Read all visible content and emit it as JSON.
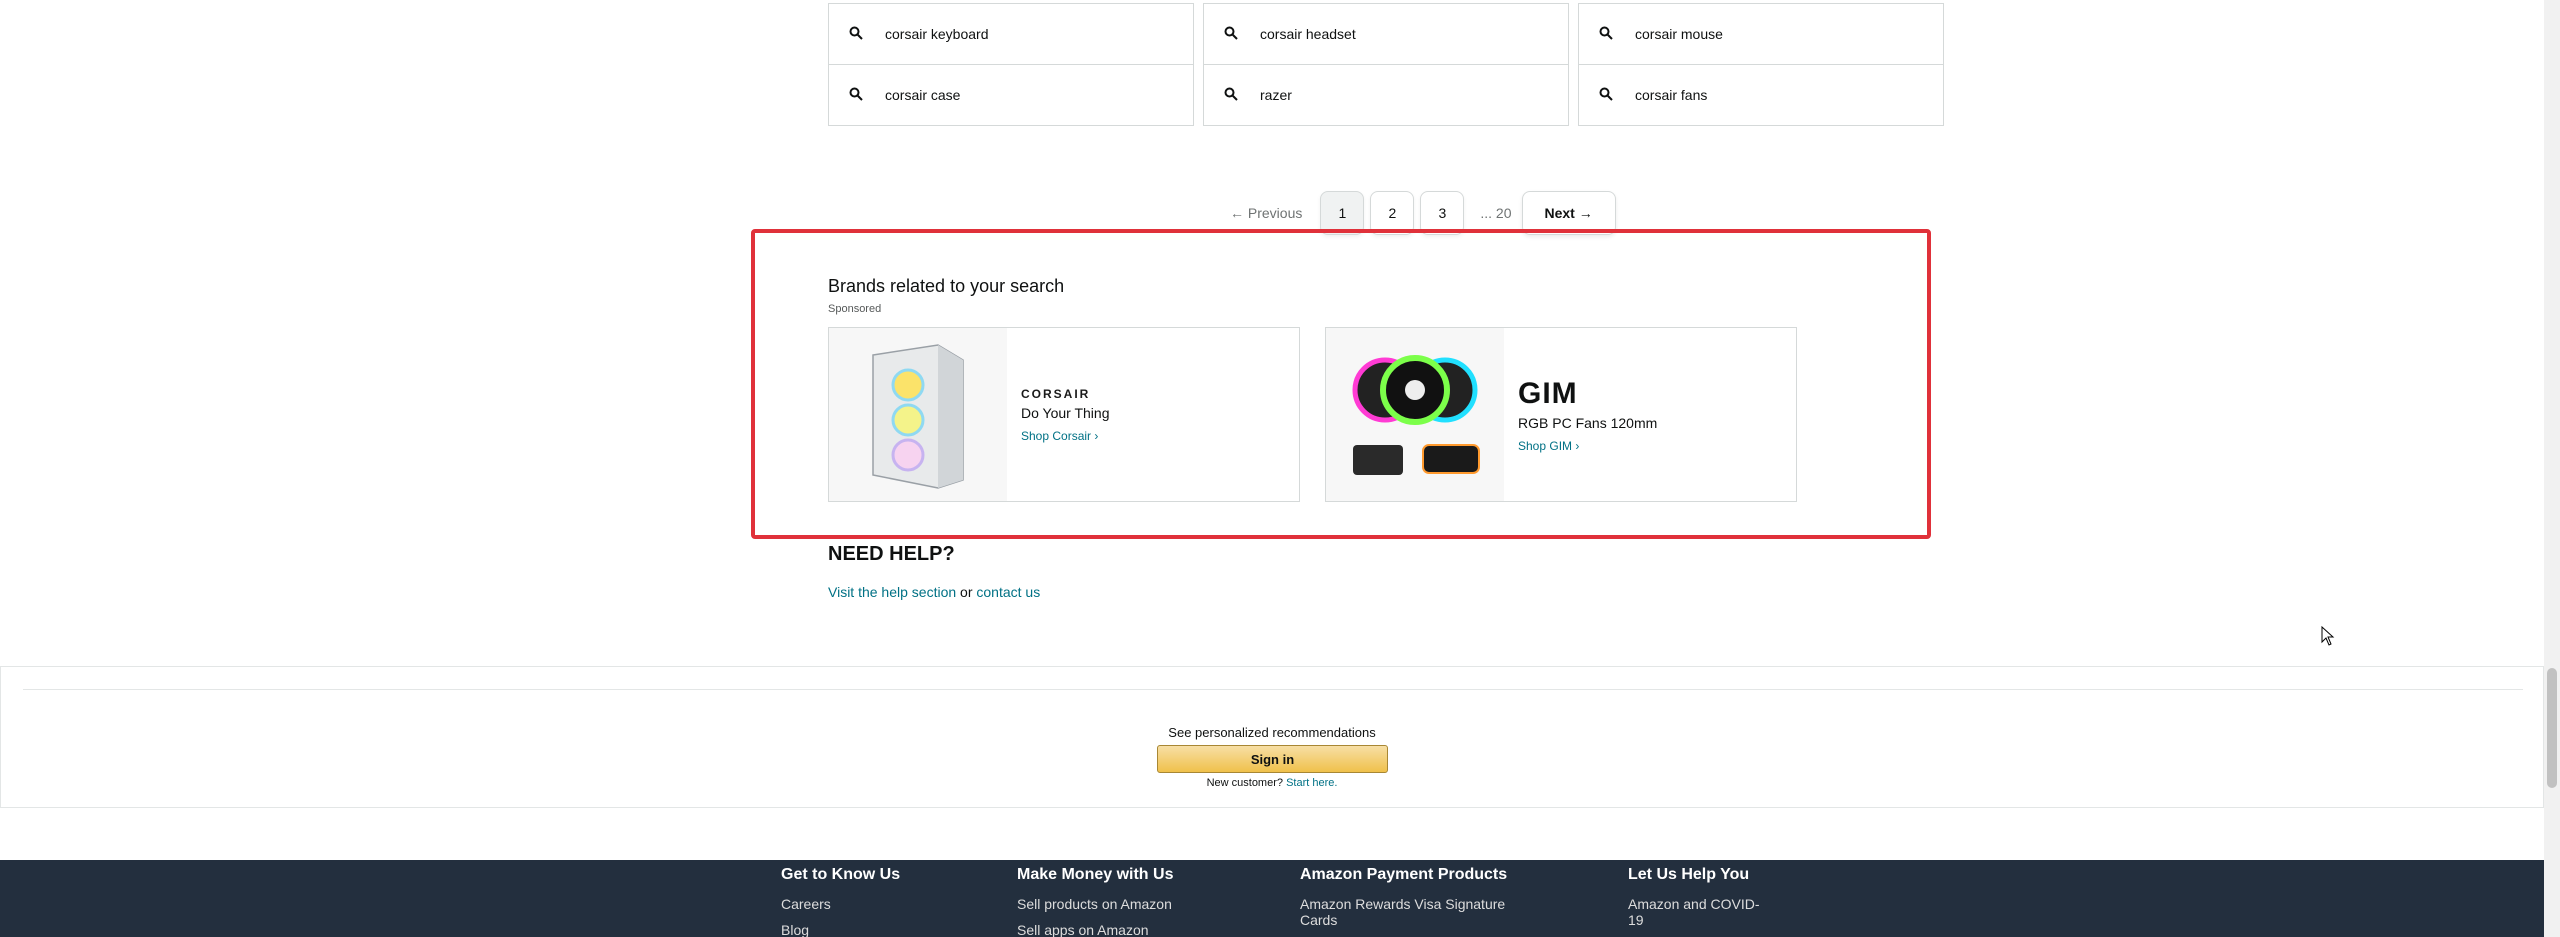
{
  "related_searches": [
    {
      "label": "corsair keyboard",
      "icon": "search-icon"
    },
    {
      "label": "corsair headset",
      "icon": "search-icon"
    },
    {
      "label": "corsair mouse",
      "icon": "search-icon"
    },
    {
      "label": "corsair case",
      "icon": "search-icon"
    },
    {
      "label": "razer",
      "icon": "search-icon"
    },
    {
      "label": "corsair fans",
      "icon": "search-icon"
    }
  ],
  "pagination": {
    "previous": "← Previous",
    "pages": [
      "1",
      "2",
      "3"
    ],
    "current": "1",
    "ellipsis": "... 20",
    "next": "Next →"
  },
  "brands": {
    "title": "Brands related to your search",
    "sponsored": "Sponsored",
    "cards": [
      {
        "logo": "CORSAIR",
        "tagline": "Do Your Thing",
        "link": "Shop Corsair ›"
      },
      {
        "logo": "GIM",
        "tagline": "RGB PC Fans 120mm",
        "link": "Shop GIM ›"
      }
    ]
  },
  "help": {
    "title": "NEED HELP?",
    "visit_link": "Visit the help section",
    "or": " or ",
    "contact_link": "contact us"
  },
  "signin": {
    "prompt": "See personalized recommendations",
    "button": "Sign in",
    "new_customer": "New customer? ",
    "start_here": "Start here."
  },
  "footer": {
    "columns": [
      {
        "title": "Get to Know Us",
        "items": [
          "Careers",
          "Blog"
        ]
      },
      {
        "title": "Make Money with Us",
        "items": [
          "Sell products on Amazon",
          "Sell apps on Amazon"
        ]
      },
      {
        "title": "Amazon Payment Products",
        "items": [
          "Amazon Rewards Visa Signature Cards"
        ]
      },
      {
        "title": "Let Us Help You",
        "items": [
          "Amazon and COVID-19"
        ]
      }
    ]
  },
  "colors": {
    "highlight": "#e0313a",
    "link": "#007185",
    "footer_bg": "#232f3e",
    "signin_button": "#f0c14b"
  }
}
